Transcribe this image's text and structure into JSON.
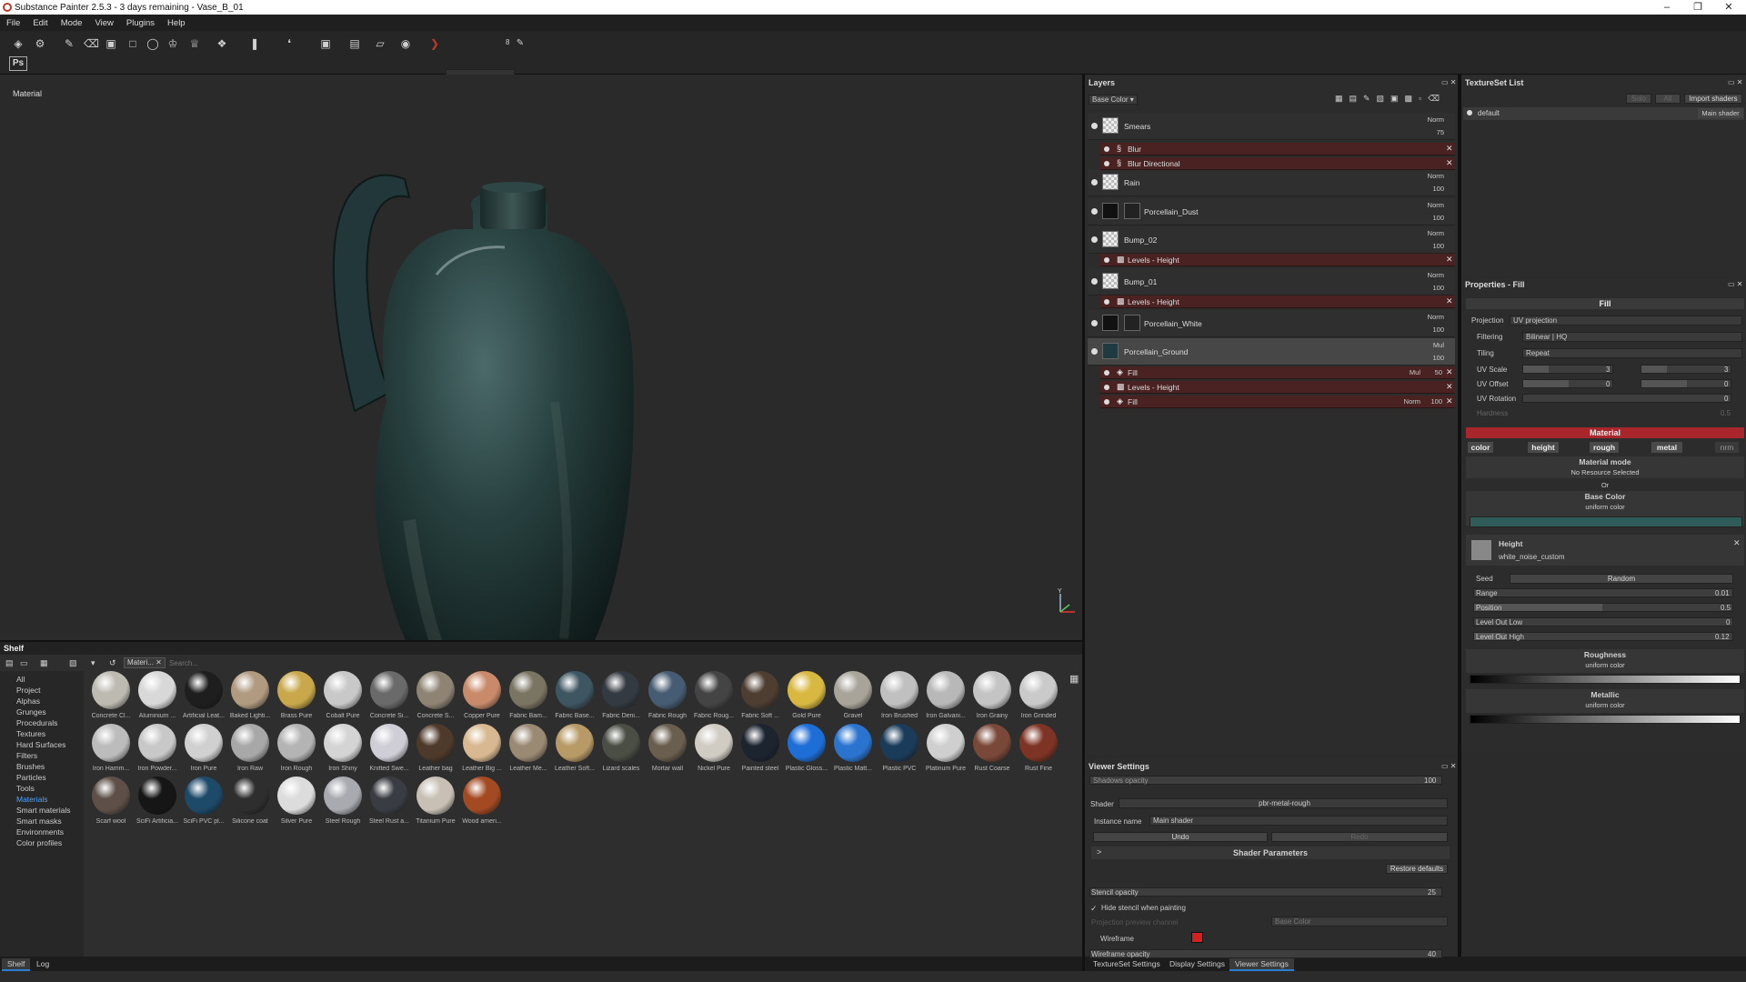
{
  "window": {
    "title": "Substance Painter 2.5.3 - 3 days remaining - Vase_B_01"
  },
  "menu": [
    "File",
    "Edit",
    "Mode",
    "View",
    "Plugins",
    "Help"
  ],
  "toolbar": {
    "brush_size": "8",
    "ps_label": "Ps"
  },
  "viewport": {
    "label": "Material"
  },
  "shelf": {
    "title": "Shelf",
    "filter_tag": "Materi...",
    "search_placeholder": "Search...",
    "categories": [
      "All",
      "Project",
      "Alphas",
      "Grunges",
      "Procedurals",
      "Textures",
      "Hard Surfaces",
      "Filters",
      "Brushes",
      "Particles",
      "Tools",
      "Materials",
      "Smart materials",
      "Smart masks",
      "Environments",
      "Color profiles"
    ],
    "selected_category": "Materials",
    "materials": [
      {
        "name": "Concrete Cl...",
        "color": "#bdbab2"
      },
      {
        "name": "Aluminium ...",
        "color": "#d8d8d8"
      },
      {
        "name": "Artificial Leat...",
        "color": "#1e1e1e"
      },
      {
        "name": "Baked Lighti...",
        "color": "#b09a80"
      },
      {
        "name": "Brass Pure",
        "color": "#c8a84a"
      },
      {
        "name": "Cobalt Pure",
        "color": "#c8c8c8"
      },
      {
        "name": "Concrete Si...",
        "color": "#6a6a6a"
      },
      {
        "name": "Concrete S...",
        "color": "#8f8474"
      },
      {
        "name": "Copper Pure",
        "color": "#c88a6a"
      },
      {
        "name": "Fabric Bam...",
        "color": "#7a7462"
      },
      {
        "name": "Fabric Base...",
        "color": "#3e5662"
      },
      {
        "name": "Fabric Deni...",
        "color": "#343a42"
      },
      {
        "name": "Fabric Rough",
        "color": "#465c72"
      },
      {
        "name": "Fabric Roug...",
        "color": "#444"
      },
      {
        "name": "Fabric Soft ...",
        "color": "#4e3e32"
      },
      {
        "name": "Gold Pure",
        "color": "#d8b840"
      },
      {
        "name": "Gravel",
        "color": "#a8a49a"
      },
      {
        "name": "Iron Brushed",
        "color": "#c0c0c0"
      },
      {
        "name": "Iron Galvani...",
        "color": "#b8b8b8"
      },
      {
        "name": "Iron Grainy",
        "color": "#c4c4c4"
      },
      {
        "name": "Iron Grinded",
        "color": "#cacaca"
      },
      {
        "name": "Iron Hamm...",
        "color": "#bcbcbc"
      },
      {
        "name": "Iron Powder...",
        "color": "#c8c8c8"
      },
      {
        "name": "Iron Pure",
        "color": "#d0d0d0"
      },
      {
        "name": "Iron Raw",
        "color": "#a8a8a8"
      },
      {
        "name": "Iron Rough",
        "color": "#b4b4b4"
      },
      {
        "name": "Iron Shiny",
        "color": "#d4d4d4"
      },
      {
        "name": "Knitted Swe...",
        "color": "#cfcdd6"
      },
      {
        "name": "Leather bag",
        "color": "#4e3a2a"
      },
      {
        "name": "Leather Big ...",
        "color": "#d8b890"
      },
      {
        "name": "Leather Me...",
        "color": "#9a8a74"
      },
      {
        "name": "Leather Soft...",
        "color": "#b89a66"
      },
      {
        "name": "Lizard scales",
        "color": "#4a4e44"
      },
      {
        "name": "Mortar wall",
        "color": "#6a5e4e"
      },
      {
        "name": "Nickel Pure",
        "color": "#d0ccc4"
      },
      {
        "name": "Painted steel",
        "color": "#1c2430"
      },
      {
        "name": "Plastic Gloss...",
        "color": "#1e6ed8"
      },
      {
        "name": "Plastic Matt...",
        "color": "#2a74d0"
      },
      {
        "name": "Plastic PVC",
        "color": "#1a3c5a"
      },
      {
        "name": "Platinum Pure",
        "color": "#cfcfcf"
      },
      {
        "name": "Rust Coarse",
        "color": "#7a4838"
      },
      {
        "name": "Rust Fine",
        "color": "#7e3424"
      },
      {
        "name": "Scarf wool",
        "color": "#5e5048"
      },
      {
        "name": "SciFi Artificia...",
        "color": "#161616"
      },
      {
        "name": "SciFi PVC pl...",
        "color": "#1e4a6a"
      },
      {
        "name": "Silicone coat",
        "color": "#2e2e2e"
      },
      {
        "name": "Silver Pure",
        "color": "#dcdcdc"
      },
      {
        "name": "Steel Rough",
        "color": "#a8aab0"
      },
      {
        "name": "Steel Rust a...",
        "color": "#3a3c44"
      },
      {
        "name": "Titanium Pure",
        "color": "#c8c0b4"
      },
      {
        "name": "Wood ameri...",
        "color": "#a44a22"
      }
    ]
  },
  "bottom_tabs": {
    "shelf": "Shelf",
    "log": "Log"
  },
  "layers": {
    "title": "Layers",
    "channel": "Base Color",
    "items": [
      {
        "name": "Smears",
        "blend": "Norm",
        "opacity": "75"
      },
      {
        "name": "Rain",
        "blend": "Norm",
        "opacity": "100"
      },
      {
        "name": "Porcellain_Dust",
        "blend": "Norm",
        "opacity": "100"
      },
      {
        "name": "Bump_02",
        "blend": "Norm",
        "opacity": "100"
      },
      {
        "name": "Bump_01",
        "blend": "Norm",
        "opacity": "100"
      },
      {
        "name": "Porcellain_White",
        "blend": "Norm",
        "opacity": "100"
      },
      {
        "name": "Porcellain_Ground",
        "blend": "Mul",
        "opacity": "100"
      }
    ],
    "effects": {
      "smears_blur": "Blur",
      "smears_blurdir": "Blur Directional",
      "bump02_levels": "Levels - Height",
      "bump01_levels": "Levels - Height",
      "ground_fill1": "Fill",
      "ground_fill1_blend": "Mul",
      "ground_fill1_op": "50",
      "ground_levels": "Levels - Height",
      "ground_fill2": "Fill",
      "ground_fill2_blend": "Norm",
      "ground_fill2_op": "100"
    }
  },
  "textureset": {
    "title": "TextureSet List",
    "solo": "Solo",
    "all": "All",
    "import": "Import shaders",
    "item": "default",
    "shader": "Main shader"
  },
  "properties": {
    "title": "Properties - Fill",
    "fill": "Fill",
    "projection_label": "Projection",
    "projection": "UV projection",
    "filtering_label": "Filtering",
    "filtering": "Bilinear | HQ",
    "tiling_label": "Tiling",
    "tiling": "Repeat",
    "uvscale_label": "UV Scale",
    "uvscale": "3",
    "uvscale2": "3",
    "uvoffset_label": "UV Offset",
    "uvoffset": "0",
    "uvoffset2": "0",
    "uvrot_label": "UV Rotation",
    "uvrot": "0",
    "hardness_label": "Hardness",
    "hardness": "0.5",
    "material": "Material",
    "channels": [
      "color",
      "height",
      "rough",
      "metal",
      "nrm"
    ],
    "matmode": "Material mode",
    "noresource": "No Resource Selected",
    "or": "Or",
    "basecolor": "Base Color",
    "uniform": "uniform color",
    "basecolor_value": "#2f5b59",
    "height": "Height",
    "height_res": "white_noise_custom",
    "seed_label": "Seed",
    "seed": "Random",
    "range_label": "Range",
    "range": "0.01",
    "position_label": "Position",
    "position": "0.5",
    "levlow_label": "Level Out Low",
    "levlow": "0",
    "levhigh_label": "Level Out High",
    "levhigh": "0.12",
    "roughness": "Roughness",
    "metallic": "Metallic"
  },
  "viewer": {
    "title": "Viewer Settings",
    "shadows_label": "Shadows opacity",
    "shadows": "100",
    "shader_label": "Shader",
    "shader": "pbr-metal-rough",
    "instance_label": "Instance name",
    "instance": "Main shader",
    "undo": "Undo",
    "redo": "Redo",
    "shaderparams": "Shader Parameters",
    "restore": "Restore defaults",
    "stencil_label": "Stencil opacity",
    "stencil": "25",
    "hidestencil": "Hide stencil when painting",
    "projection_label": "Projection preview channel",
    "projection": "Base Color",
    "wireframe": "Wireframe",
    "wireframe_color": "#d42020",
    "wireop_label": "Wireframe opacity",
    "wireop": "40",
    "tabs": [
      "TextureSet Settings",
      "Display Settings",
      "Viewer Settings"
    ]
  }
}
